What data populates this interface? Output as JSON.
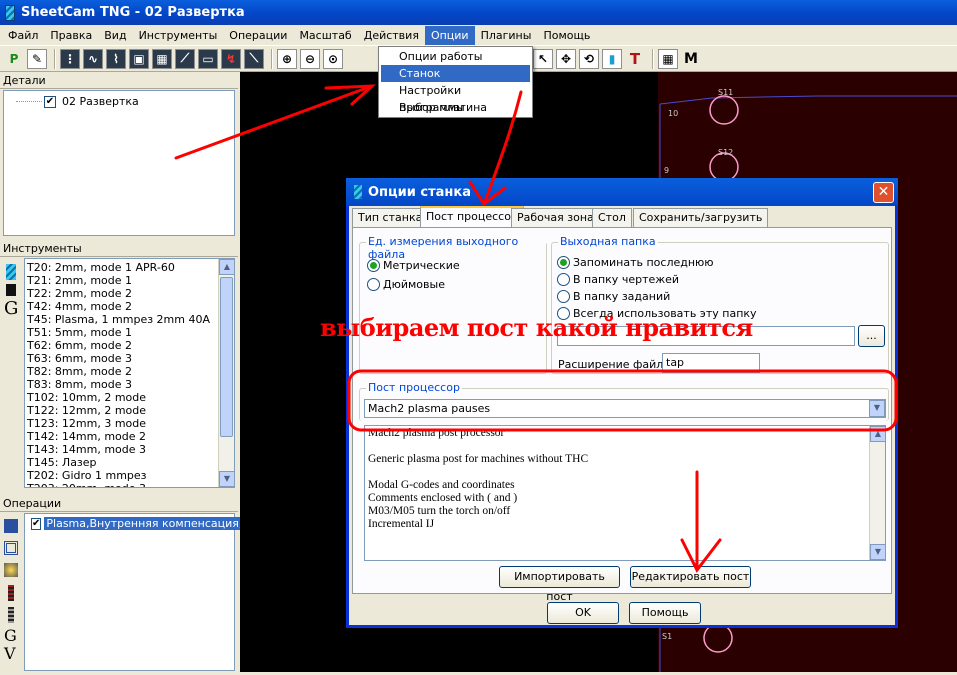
{
  "app": {
    "title": "SheetCam TNG - 02 Развертка"
  },
  "menu": [
    "Файл",
    "Правка",
    "Вид",
    "Инструменты",
    "Операции",
    "Масштаб",
    "Действия",
    "Опции",
    "Плагины",
    "Помощь"
  ],
  "options_menu": {
    "items": [
      "Опции работы",
      "Станок",
      "Настройки программы",
      "Выбор плагина"
    ],
    "highlighted": "Станок"
  },
  "parts_panel": {
    "header": "Детали",
    "items": [
      "02 Развертка"
    ]
  },
  "tools_panel": {
    "header": "Инструменты",
    "items": [
      "T20: 2mm, mode 1 APR-60",
      "T21: 2mm, mode 1",
      "T22: 2mm, mode 2",
      "T42: 4mm, mode 2",
      "T45: Plasma, 1 mmрез 2mm 40A",
      "T51: 5mm, mode 1",
      "T62: 6mm, mode 2",
      "T63: 6mm, mode 3",
      "T82: 8mm, mode 2",
      "T83: 8mm, mode 3",
      "T102: 10mm, 2 mode",
      "T122: 12mm, 2 mode",
      "T123: 12mm, 3 mode",
      "T142: 14mm, mode 2",
      "T143: 14mm, mode 3",
      "T145: Лазер",
      "T202: Gidro 1 mmрез",
      "T203: 20mm, mode 3"
    ]
  },
  "operations_panel": {
    "header": "Операции",
    "items": [
      "Plasma,Внутренняя компенсация,..."
    ]
  },
  "dialog": {
    "title": "Опции станка",
    "tabs": [
      "Тип станка",
      "Пост процессор",
      "Рабочая зона",
      "Стол",
      "Сохранить/загрузить"
    ],
    "active_tab": "Пост процессор",
    "units": {
      "legend": "Ед. измерения выходного файла",
      "options": [
        "Метрические",
        "Дюймовые"
      ],
      "selected": "Метрические"
    },
    "output_folder": {
      "legend": "Выходная папка",
      "options": [
        "Запоминать последнюю",
        "В папку чертежей",
        "В папку заданий",
        "Всегда использовать эту папку"
      ],
      "selected": "Запоминать последнюю",
      "browse_label": "...",
      "ext_label": "Расширение файла",
      "ext_value": "tap"
    },
    "post": {
      "legend": "Пост процессор",
      "selected": "Mach2 plasma pauses",
      "description": [
        "Mach2 plasma post processor",
        "",
        "Generic plasma post for machines without THC",
        "",
        "Modal G-codes and coordinates",
        "Comments enclosed with ( and )",
        "M03/M05 turn the torch on/off",
        "Incremental IJ"
      ]
    },
    "buttons": {
      "import": "Импортировать пост",
      "edit": "Редактировать пост",
      "ok": "OK",
      "help": "Помощь"
    }
  },
  "annotation": {
    "text": "выбираем пост какой нравится"
  },
  "drawing_labels": [
    "S11",
    "S12",
    "10",
    "9",
    "S1"
  ],
  "colors": {
    "annotation": "#ff0000",
    "title_bar": "#0a5fdc",
    "selection": "#316ac5"
  }
}
